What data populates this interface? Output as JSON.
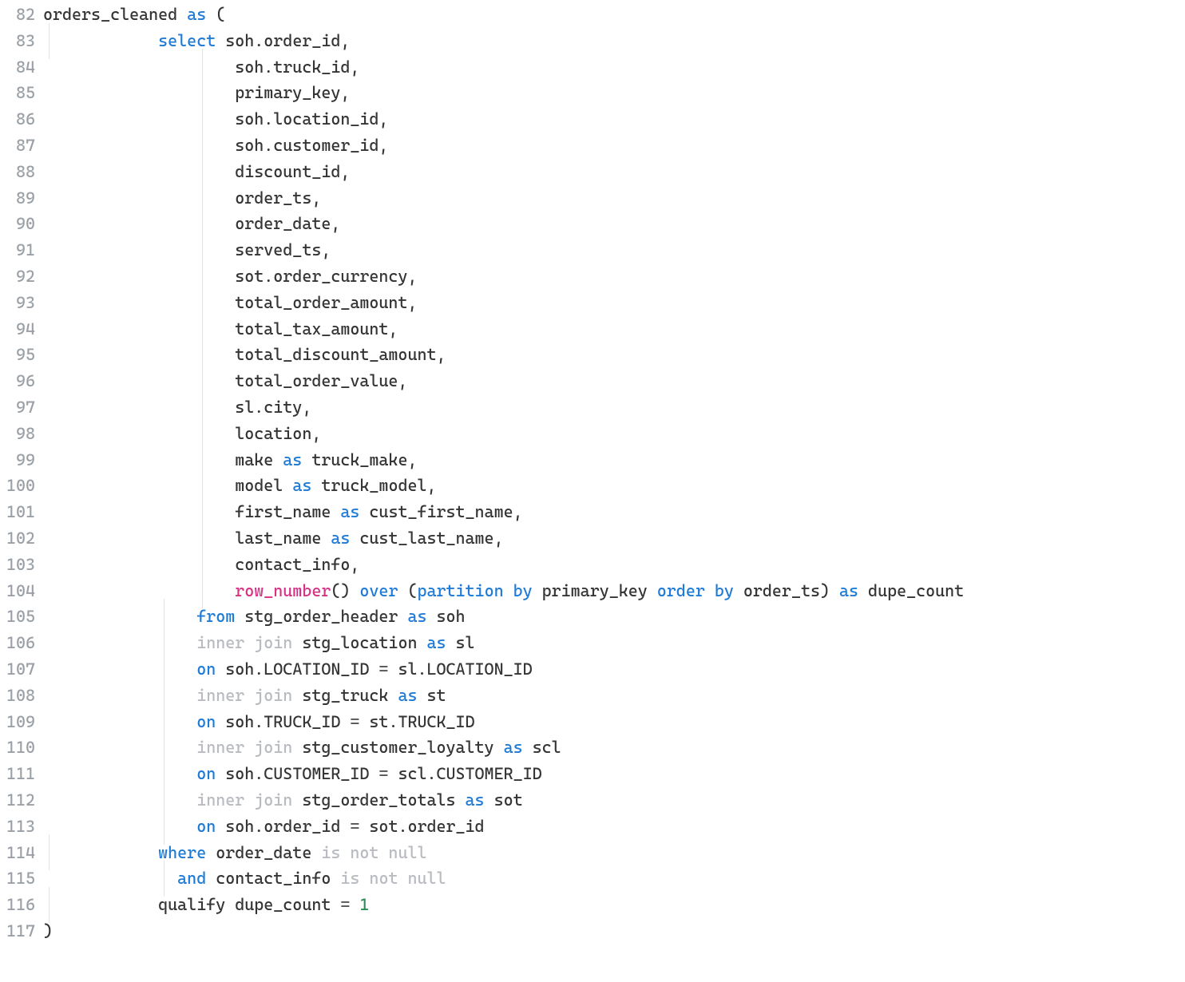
{
  "language": "sql",
  "first_line_number": 82,
  "lines": [
    {
      "indent": 0,
      "guides": [],
      "tokens": [
        {
          "t": "orders_cleaned ",
          "c": "tk-default"
        },
        {
          "t": "as",
          "c": "tk-kw"
        },
        {
          "t": " (",
          "c": "tk-default"
        }
      ]
    },
    {
      "indent": 12,
      "guides": [
        "a"
      ],
      "tokens": [
        {
          "t": "select",
          "c": "tk-kw"
        },
        {
          "t": " soh.order_id,",
          "c": "tk-default"
        }
      ]
    },
    {
      "indent": 20,
      "guides": [
        "a",
        "b",
        "c"
      ],
      "tokens": [
        {
          "t": "soh.truck_id,",
          "c": "tk-default"
        }
      ]
    },
    {
      "indent": 20,
      "guides": [
        "a",
        "b",
        "c"
      ],
      "tokens": [
        {
          "t": "primary_key,",
          "c": "tk-default"
        }
      ]
    },
    {
      "indent": 20,
      "guides": [
        "a",
        "b",
        "c"
      ],
      "tokens": [
        {
          "t": "soh.location_id,",
          "c": "tk-default"
        }
      ]
    },
    {
      "indent": 20,
      "guides": [
        "a",
        "b",
        "c"
      ],
      "tokens": [
        {
          "t": "soh.customer_id,",
          "c": "tk-default"
        }
      ]
    },
    {
      "indent": 20,
      "guides": [
        "a",
        "b",
        "c"
      ],
      "tokens": [
        {
          "t": "discount_id,",
          "c": "tk-default"
        }
      ]
    },
    {
      "indent": 20,
      "guides": [
        "a",
        "b",
        "c"
      ],
      "tokens": [
        {
          "t": "order_ts,",
          "c": "tk-default"
        }
      ]
    },
    {
      "indent": 20,
      "guides": [
        "a",
        "b",
        "c"
      ],
      "tokens": [
        {
          "t": "order_date,",
          "c": "tk-default"
        }
      ]
    },
    {
      "indent": 20,
      "guides": [
        "a",
        "b",
        "c"
      ],
      "tokens": [
        {
          "t": "served_ts,",
          "c": "tk-default"
        }
      ]
    },
    {
      "indent": 20,
      "guides": [
        "a",
        "b",
        "c"
      ],
      "tokens": [
        {
          "t": "sot.order_currency,",
          "c": "tk-default"
        }
      ]
    },
    {
      "indent": 20,
      "guides": [
        "a",
        "b",
        "c"
      ],
      "tokens": [
        {
          "t": "total_order_amount,",
          "c": "tk-default"
        }
      ]
    },
    {
      "indent": 20,
      "guides": [
        "a",
        "b",
        "c"
      ],
      "tokens": [
        {
          "t": "total_tax_amount,",
          "c": "tk-default"
        }
      ]
    },
    {
      "indent": 20,
      "guides": [
        "a",
        "b",
        "c"
      ],
      "tokens": [
        {
          "t": "total_discount_amount,",
          "c": "tk-default"
        }
      ]
    },
    {
      "indent": 20,
      "guides": [
        "a",
        "b",
        "c"
      ],
      "tokens": [
        {
          "t": "total_order_value,",
          "c": "tk-default"
        }
      ]
    },
    {
      "indent": 20,
      "guides": [
        "a",
        "b",
        "c"
      ],
      "tokens": [
        {
          "t": "sl.city,",
          "c": "tk-default"
        }
      ]
    },
    {
      "indent": 20,
      "guides": [
        "a",
        "b",
        "c"
      ],
      "tokens": [
        {
          "t": "location,",
          "c": "tk-default"
        }
      ]
    },
    {
      "indent": 20,
      "guides": [
        "a",
        "b",
        "c"
      ],
      "tokens": [
        {
          "t": "make ",
          "c": "tk-default"
        },
        {
          "t": "as",
          "c": "tk-kw"
        },
        {
          "t": " truck_make,",
          "c": "tk-default"
        }
      ]
    },
    {
      "indent": 20,
      "guides": [
        "a",
        "b",
        "c"
      ],
      "tokens": [
        {
          "t": "model ",
          "c": "tk-default"
        },
        {
          "t": "as",
          "c": "tk-kw"
        },
        {
          "t": " truck_model,",
          "c": "tk-default"
        }
      ]
    },
    {
      "indent": 20,
      "guides": [
        "a",
        "b",
        "c"
      ],
      "tokens": [
        {
          "t": "first_name ",
          "c": "tk-default"
        },
        {
          "t": "as",
          "c": "tk-kw"
        },
        {
          "t": " cust_first_name,",
          "c": "tk-default"
        }
      ]
    },
    {
      "indent": 20,
      "guides": [
        "a",
        "b",
        "c"
      ],
      "tokens": [
        {
          "t": "last_name ",
          "c": "tk-default"
        },
        {
          "t": "as",
          "c": "tk-kw"
        },
        {
          "t": " cust_last_name,",
          "c": "tk-default"
        }
      ]
    },
    {
      "indent": 20,
      "guides": [
        "a",
        "b",
        "c"
      ],
      "tokens": [
        {
          "t": "contact_info,",
          "c": "tk-default"
        }
      ]
    },
    {
      "indent": 20,
      "guides": [
        "a",
        "b",
        "c"
      ],
      "tokens": [
        {
          "t": "row_number",
          "c": "tk-func"
        },
        {
          "t": "() ",
          "c": "tk-default"
        },
        {
          "t": "over",
          "c": "tk-kw"
        },
        {
          "t": " (",
          "c": "tk-default"
        },
        {
          "t": "partition by",
          "c": "tk-kw"
        },
        {
          "t": " primary_key ",
          "c": "tk-default"
        },
        {
          "t": "order by",
          "c": "tk-kw"
        },
        {
          "t": " order_ts) ",
          "c": "tk-default"
        },
        {
          "t": "as",
          "c": "tk-kw"
        },
        {
          "t": " dupe_count",
          "c": "tk-default"
        }
      ]
    },
    {
      "indent": 16,
      "guides": [
        "a",
        "b"
      ],
      "tokens": [
        {
          "t": "from",
          "c": "tk-kw"
        },
        {
          "t": " stg_order_header ",
          "c": "tk-default"
        },
        {
          "t": "as",
          "c": "tk-kw"
        },
        {
          "t": " soh",
          "c": "tk-default"
        }
      ]
    },
    {
      "indent": 16,
      "guides": [
        "a",
        "b"
      ],
      "tokens": [
        {
          "t": "inner join",
          "c": "tk-join"
        },
        {
          "t": " stg_location ",
          "c": "tk-default"
        },
        {
          "t": "as",
          "c": "tk-kw"
        },
        {
          "t": " sl",
          "c": "tk-default"
        }
      ]
    },
    {
      "indent": 16,
      "guides": [
        "a",
        "b"
      ],
      "tokens": [
        {
          "t": "on",
          "c": "tk-kw"
        },
        {
          "t": " soh.LOCATION_ID ",
          "c": "tk-default"
        },
        {
          "t": "=",
          "c": "tk-punct"
        },
        {
          "t": " sl.LOCATION_ID",
          "c": "tk-default"
        }
      ]
    },
    {
      "indent": 16,
      "guides": [
        "a",
        "b"
      ],
      "tokens": [
        {
          "t": "inner join",
          "c": "tk-join"
        },
        {
          "t": " stg_truck ",
          "c": "tk-default"
        },
        {
          "t": "as",
          "c": "tk-kw"
        },
        {
          "t": " st",
          "c": "tk-default"
        }
      ]
    },
    {
      "indent": 16,
      "guides": [
        "a",
        "b"
      ],
      "tokens": [
        {
          "t": "on",
          "c": "tk-kw"
        },
        {
          "t": " soh.TRUCK_ID ",
          "c": "tk-default"
        },
        {
          "t": "=",
          "c": "tk-punct"
        },
        {
          "t": " st.TRUCK_ID",
          "c": "tk-default"
        }
      ]
    },
    {
      "indent": 16,
      "guides": [
        "a",
        "b"
      ],
      "tokens": [
        {
          "t": "inner join",
          "c": "tk-join"
        },
        {
          "t": " stg_customer_loyalty ",
          "c": "tk-default"
        },
        {
          "t": "as",
          "c": "tk-kw"
        },
        {
          "t": " scl",
          "c": "tk-default"
        }
      ]
    },
    {
      "indent": 16,
      "guides": [
        "a",
        "b"
      ],
      "tokens": [
        {
          "t": "on",
          "c": "tk-kw"
        },
        {
          "t": " soh.CUSTOMER_ID ",
          "c": "tk-default"
        },
        {
          "t": "=",
          "c": "tk-punct"
        },
        {
          "t": " scl.CUSTOMER_ID",
          "c": "tk-default"
        }
      ]
    },
    {
      "indent": 16,
      "guides": [
        "a",
        "b"
      ],
      "tokens": [
        {
          "t": "inner join",
          "c": "tk-join"
        },
        {
          "t": " stg_order_totals ",
          "c": "tk-default"
        },
        {
          "t": "as",
          "c": "tk-kw"
        },
        {
          "t": " sot",
          "c": "tk-default"
        }
      ]
    },
    {
      "indent": 16,
      "guides": [
        "a",
        "b"
      ],
      "tokens": [
        {
          "t": "on",
          "c": "tk-kw"
        },
        {
          "t": " soh.order_id ",
          "c": "tk-default"
        },
        {
          "t": "=",
          "c": "tk-punct"
        },
        {
          "t": " sot.order_id",
          "c": "tk-default"
        }
      ]
    },
    {
      "indent": 12,
      "guides": [
        "a"
      ],
      "tokens": [
        {
          "t": "where",
          "c": "tk-kw"
        },
        {
          "t": " order_date ",
          "c": "tk-default"
        },
        {
          "t": "is not null",
          "c": "tk-join"
        }
      ]
    },
    {
      "indent": 14,
      "guides": [
        "a",
        "b"
      ],
      "tokens": [
        {
          "t": "and",
          "c": "tk-kw"
        },
        {
          "t": " contact_info ",
          "c": "tk-default"
        },
        {
          "t": "is not null",
          "c": "tk-join"
        }
      ]
    },
    {
      "indent": 12,
      "guides": [
        "a"
      ],
      "tokens": [
        {
          "t": "qualify dupe_count ",
          "c": "tk-default"
        },
        {
          "t": "=",
          "c": "tk-punct"
        },
        {
          "t": " ",
          "c": "tk-default"
        },
        {
          "t": "1",
          "c": "tk-num"
        }
      ]
    },
    {
      "indent": 0,
      "guides": [],
      "tokens": [
        {
          "t": ")",
          "c": "tk-default"
        }
      ]
    }
  ]
}
